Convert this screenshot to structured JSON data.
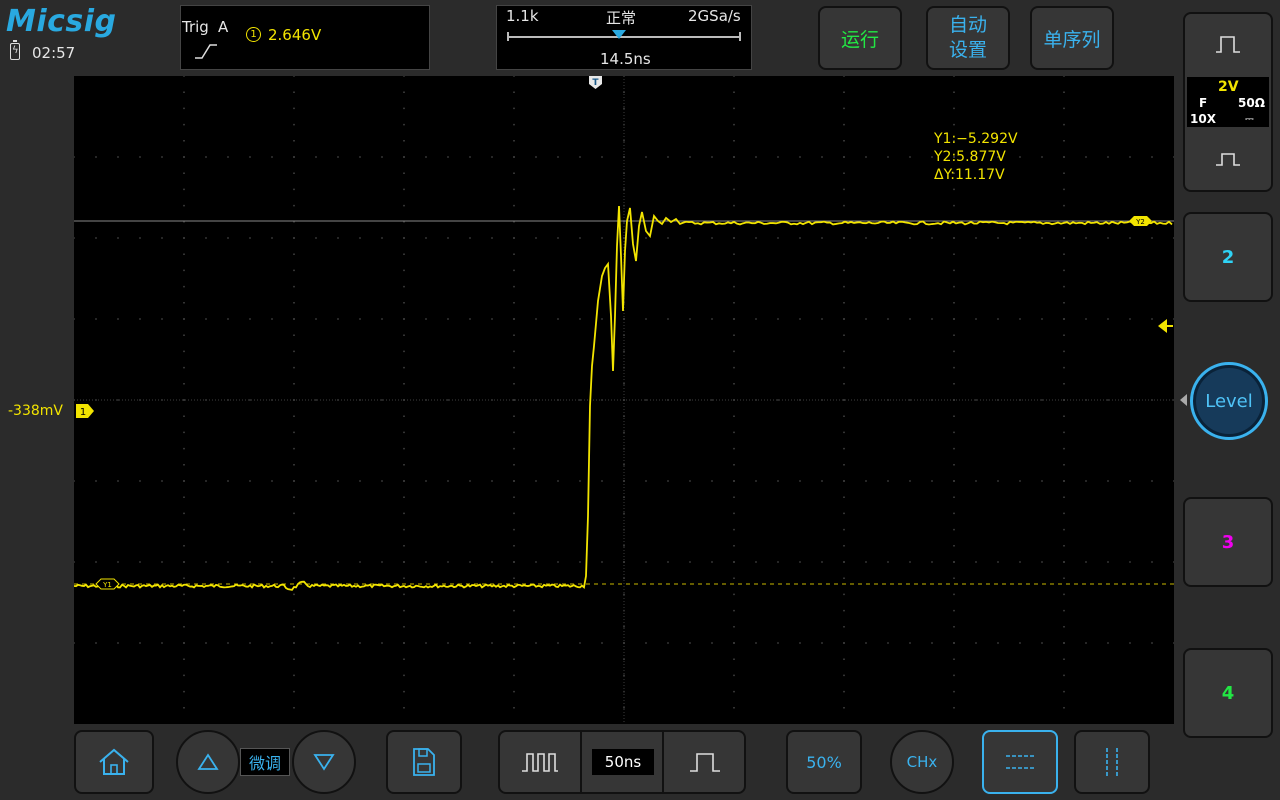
{
  "header": {
    "brand": "Micsig",
    "clock": "02:57"
  },
  "trigger": {
    "label": "Trig",
    "source_letter": "A",
    "channel": "1",
    "level": "2.646V",
    "edge": "rising"
  },
  "timebase_status": {
    "memory": "1.1k",
    "mode": "正常",
    "sample_rate": "2GSa/s",
    "delay": "14.5ns"
  },
  "top_buttons": {
    "run": "运行",
    "auto_line1": "自动",
    "auto_line2": "设置",
    "single": "单序列"
  },
  "channel1": {
    "offset_label": "-338mV",
    "marker": "1",
    "scale": "2V",
    "coupling": "F",
    "impedance": "50Ω",
    "probe": "10X",
    "bw_symbol": "⎓",
    "color": "#f2e400"
  },
  "channels": {
    "ch2": "2",
    "ch3": "3",
    "ch4": "4",
    "ch2_color": "#2fd3f5",
    "ch3_color": "#f000f0",
    "ch4_color": "#22e844"
  },
  "cursors": {
    "y1": "Y1:−5.292V",
    "y2": "Y2:5.877V",
    "dy": "ΔY:11.17V",
    "y1_tag": "Y1",
    "y2_tag": "Y2"
  },
  "trigger_marker": "T",
  "level_knob": "Level",
  "bottom": {
    "fine_label": "微调",
    "timebase_value": "50ns",
    "fifty_label": "50%",
    "chx_label": "CHx"
  },
  "icons": {
    "home": "home-icon",
    "up": "triangle-up-icon",
    "down": "triangle-down-icon",
    "save": "save-icon",
    "narrow_pulse": "narrow-pulse-icon",
    "wide_pulse": "wide-pulse-icon",
    "h_cursor": "horizontal-cursor-icon",
    "v_cursor": "vertical-cursor-icon"
  },
  "colors": {
    "accent": "#3ab2ee",
    "run": "#22e844",
    "trace": "#f2e400"
  }
}
